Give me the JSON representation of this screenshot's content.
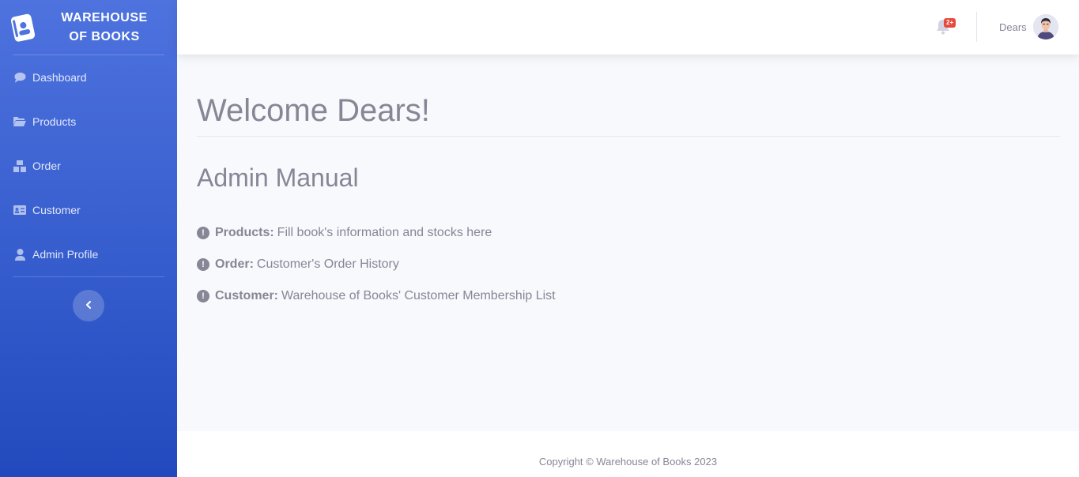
{
  "brand": {
    "line1": "WAREHOUSE",
    "line2": "OF BOOKS",
    "logo_icon": "book-user-icon"
  },
  "sidebar": {
    "items": [
      {
        "label": "Dashboard",
        "icon": "comment-icon"
      },
      {
        "label": "Products",
        "icon": "folder-open-icon"
      },
      {
        "label": "Order",
        "icon": "boxes-icon"
      },
      {
        "label": "Customer",
        "icon": "id-card-icon"
      },
      {
        "label": "Admin Profile",
        "icon": "user-icon"
      }
    ],
    "toggle_icon": "chevron-left-icon"
  },
  "topbar": {
    "alert_badge": "2+",
    "user_name": "Dears"
  },
  "main": {
    "welcome": "Welcome Dears!",
    "manual_title": "Admin Manual",
    "items": [
      {
        "label": "Products:",
        "text": "Fill book's information and stocks here"
      },
      {
        "label": "Order:",
        "text": "Customer's Order History"
      },
      {
        "label": "Customer:",
        "text": "Warehouse of Books' Customer Membership List"
      }
    ]
  },
  "footer": {
    "text": "Copyright © Warehouse of Books 2023"
  },
  "colors": {
    "sidebar_top": "#4e73df",
    "sidebar_bottom": "#224abe",
    "badge": "#e74a3b",
    "text": "#858796"
  }
}
